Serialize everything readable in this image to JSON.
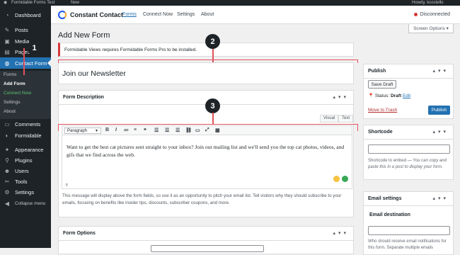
{
  "adminbar": {
    "site": "Formidable Forms Test",
    "new": "New",
    "howdy": "Howdy, kcostello"
  },
  "sidebar": {
    "items": [
      {
        "label": "Dashboard",
        "icon": "dashboard-icon"
      },
      {
        "label": "Posts",
        "icon": "pin-icon"
      },
      {
        "label": "Media",
        "icon": "media-icon"
      },
      {
        "label": "Pages",
        "icon": "pages-icon"
      },
      {
        "label": "Contact Form",
        "icon": "contact-form-icon"
      },
      {
        "label": "Comments",
        "icon": "comments-icon"
      },
      {
        "label": "Formidable",
        "icon": "formidable-icon"
      },
      {
        "label": "Appearance",
        "icon": "appearance-icon"
      },
      {
        "label": "Plugins",
        "icon": "plugins-icon"
      },
      {
        "label": "Users",
        "icon": "users-icon"
      },
      {
        "label": "Tools",
        "icon": "tools-icon"
      },
      {
        "label": "Settings",
        "icon": "settings-icon"
      },
      {
        "label": "Collapse menu",
        "icon": "collapse-icon"
      }
    ],
    "submenu": [
      "Forms",
      "Add Form",
      "Connect Now",
      "Settings",
      "About"
    ]
  },
  "topnav": {
    "brand": "Constant Contact",
    "tabs": [
      "Forms",
      "Connect Now",
      "Settings",
      "About"
    ],
    "status": "Disconnected"
  },
  "screen_options": "Screen Options ▾",
  "page_title": "Add New Form",
  "notice": "Formidable Views requires Formidable Forms Pro to be installed.",
  "form_title": "Join our Newsletter",
  "description_panel": {
    "title": "Form Description",
    "tabs": [
      "Visual",
      "Text"
    ],
    "format": "Paragraph",
    "content": "Want to get the best cat pictures sent straight to your inbox? Join our mailing list and we'll send you the top cat photos, videos, and gifs that we find across the web.",
    "path": "p",
    "help": "This message will display above the form fields, so use it as an opportunity to pitch your email list. Tell visitors why they should subscribe to your emails, focusing on benefits like insider tips, discounts, subscriber coupons, and more."
  },
  "form_options": {
    "title": "Form Options"
  },
  "publish": {
    "title": "Publish",
    "save_draft": "Save Draft",
    "status_label": "Status:",
    "status_value": "Draft",
    "edit": "Edit",
    "trash": "Move to Trash",
    "publish_btn": "Publish"
  },
  "shortcode": {
    "title": "Shortcode",
    "label": "Shortcode to embed",
    "hint": "— You can copy and paste this in a post to display your form."
  },
  "email_settings": {
    "title": "Email settings",
    "destination": "Email destination",
    "hint": "Who should receive email notifications for this form. Separate multiple emails"
  },
  "callouts": [
    "1",
    "2",
    "3"
  ],
  "colors": {
    "accent": "#2271b1",
    "callout_line": "#e0525a",
    "sidebar": "#1d2327"
  }
}
